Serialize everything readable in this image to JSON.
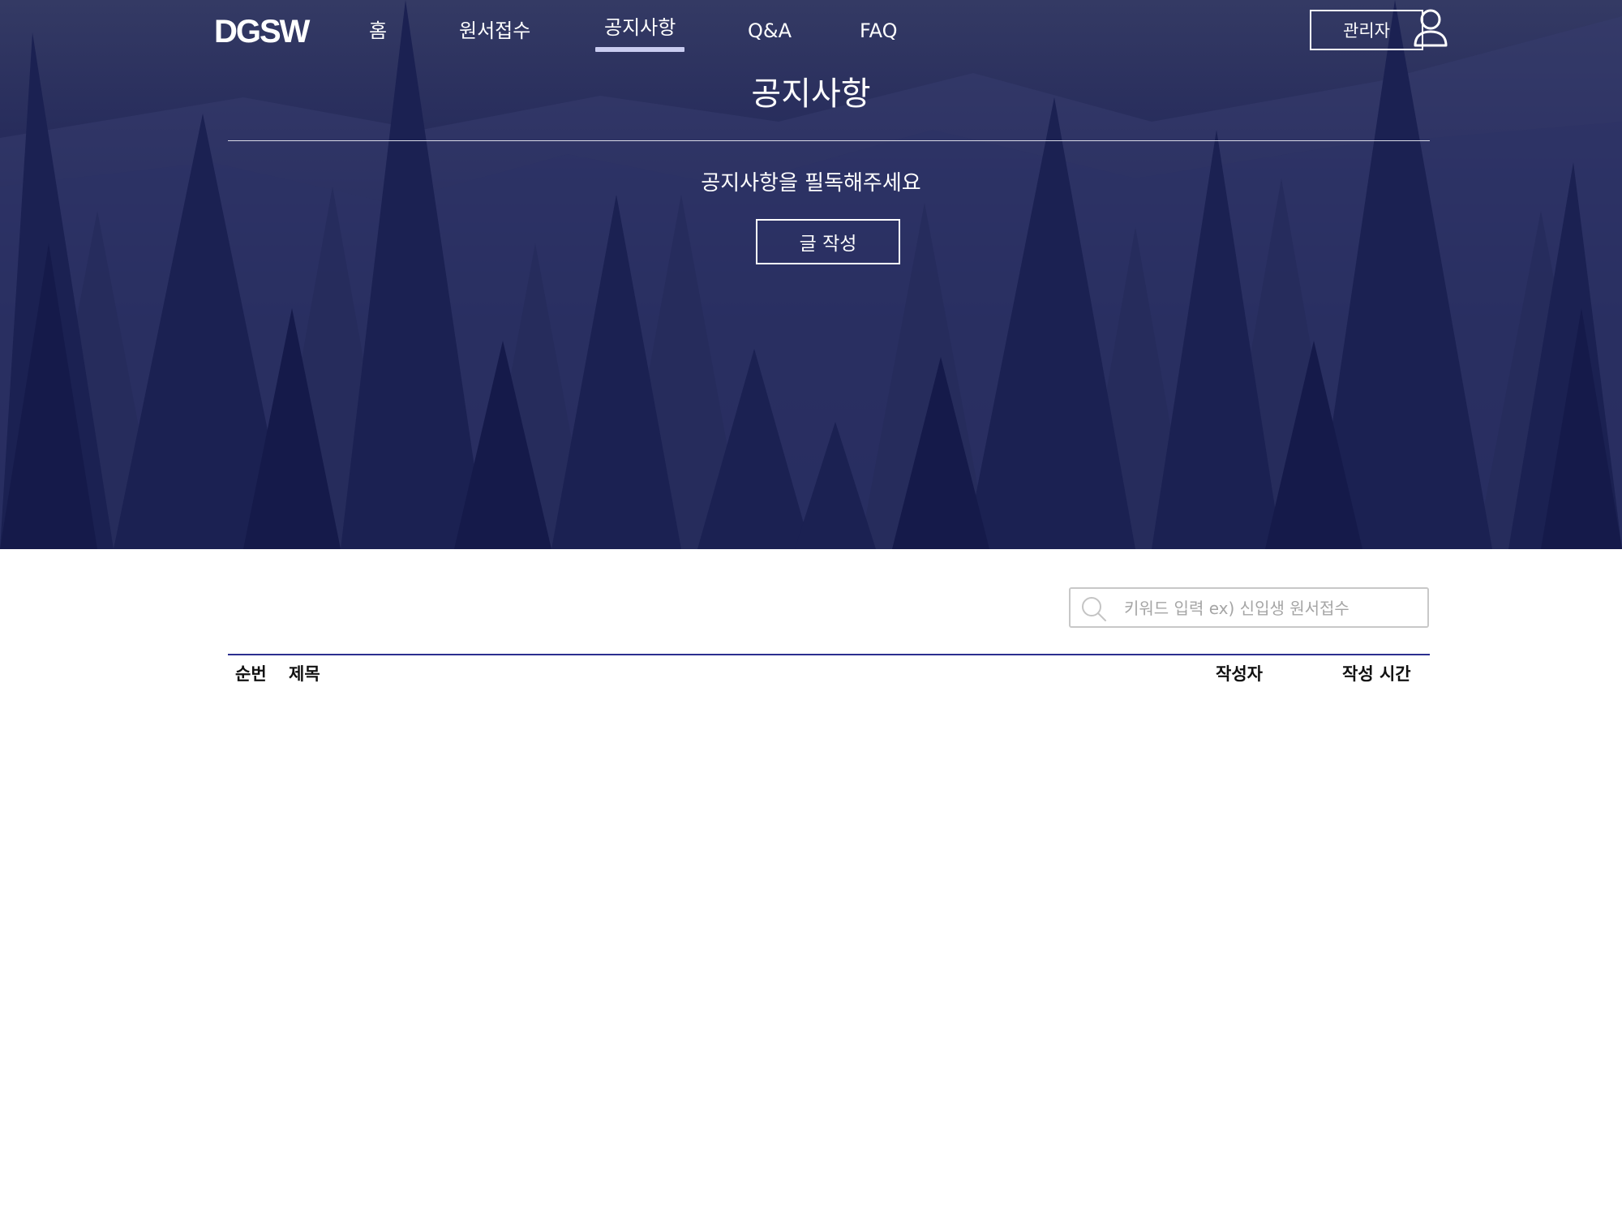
{
  "brand": {
    "logo": "DGSW"
  },
  "nav": {
    "items": [
      {
        "label": "홈"
      },
      {
        "label": "원서접수"
      },
      {
        "label": "공지사항",
        "active": true
      },
      {
        "label": "Q&A"
      },
      {
        "label": "FAQ"
      }
    ],
    "admin_label": "관리자"
  },
  "hero": {
    "title": "공지사항",
    "subtitle": "공지사항을 필독해주세요",
    "write_button": "글 작성"
  },
  "search": {
    "placeholder": "키워드 입력 ex) 신입생 원서접수",
    "value": ""
  },
  "table": {
    "columns": [
      "순번",
      "제목",
      "작성자",
      "작성 시간"
    ],
    "rows": []
  },
  "colors": {
    "hero_top": "#343a64",
    "hero_bottom": "#10164a",
    "accent_line": "#2b2f8f",
    "active_underline": "#c9ccf0"
  }
}
